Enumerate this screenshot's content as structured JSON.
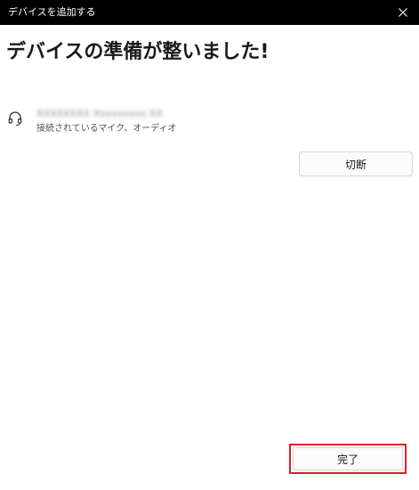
{
  "window": {
    "title": "デバイスを追加する",
    "close_icon": "close-icon"
  },
  "main": {
    "heading": "デバイスの準備が整いました!"
  },
  "device": {
    "icon": "headset-icon",
    "name": "XXXXXXXX Xxxxxxxxx XX",
    "status": "接続されているマイク、オーディオ"
  },
  "actions": {
    "disconnect_label": "切断",
    "done_label": "完了"
  },
  "colors": {
    "titlebar": "#000000",
    "background": "#ffffff",
    "highlight": "#d9222a"
  }
}
